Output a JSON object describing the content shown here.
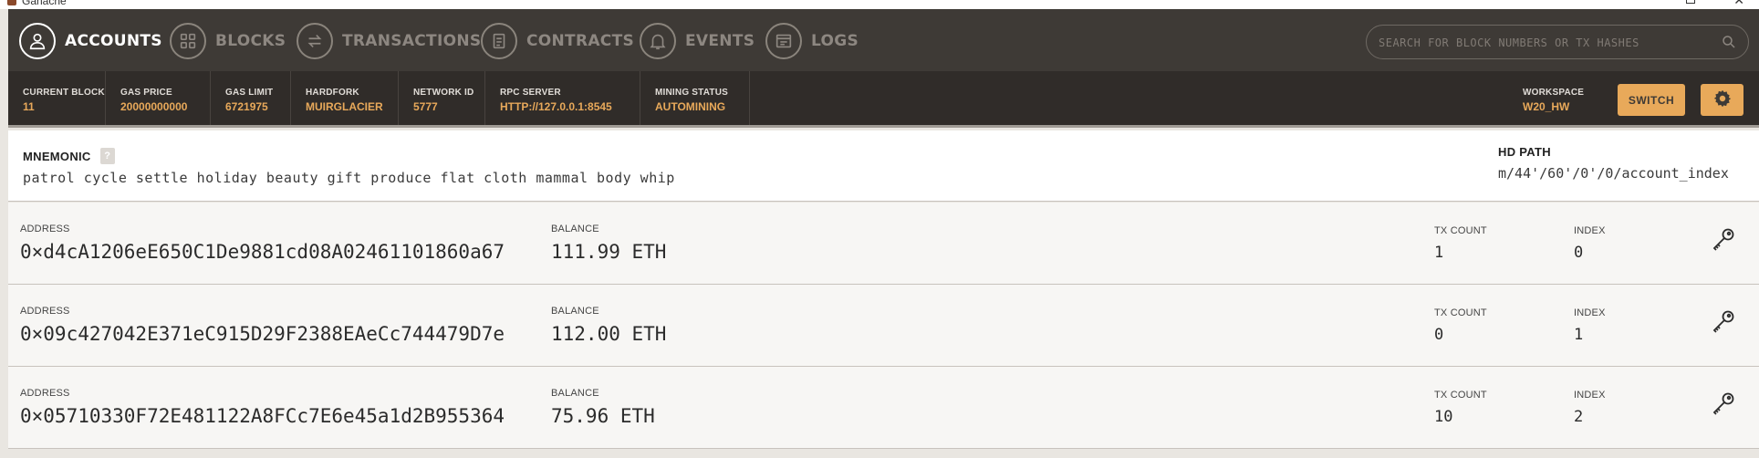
{
  "window": {
    "title": "Ganache"
  },
  "nav": {
    "items": [
      {
        "label": "ACCOUNTS",
        "icon": "user-icon",
        "active": true
      },
      {
        "label": "BLOCKS",
        "icon": "grid-icon",
        "active": false
      },
      {
        "label": "TRANSACTIONS",
        "icon": "transfer-arrows-icon",
        "active": false
      },
      {
        "label": "CONTRACTS",
        "icon": "document-icon",
        "active": false
      },
      {
        "label": "EVENTS",
        "icon": "bell-icon",
        "active": false
      },
      {
        "label": "LOGS",
        "icon": "terminal-icon",
        "active": false
      }
    ],
    "search_placeholder": "SEARCH FOR BLOCK NUMBERS OR TX HASHES"
  },
  "status": {
    "items": [
      {
        "label": "CURRENT BLOCK",
        "value": "11"
      },
      {
        "label": "GAS PRICE",
        "value": "20000000000"
      },
      {
        "label": "GAS LIMIT",
        "value": "6721975"
      },
      {
        "label": "HARDFORK",
        "value": "MUIRGLACIER"
      },
      {
        "label": "NETWORK ID",
        "value": "5777"
      },
      {
        "label": "RPC SERVER",
        "value": "HTTP://127.0.0.1:8545"
      },
      {
        "label": "MINING STATUS",
        "value": "AUTOMINING"
      }
    ],
    "workspace_label": "WORKSPACE",
    "workspace_value": "W20_HW",
    "switch_label": "SWITCH"
  },
  "mnemonic": {
    "title": "MNEMONIC",
    "help": "?",
    "phrase": "patrol cycle settle holiday beauty gift produce flat cloth mammal body whip",
    "hd_path_label": "HD PATH",
    "hd_path": "m/44'/60'/0'/0/account_index"
  },
  "accounts": [
    {
      "address_label": "ADDRESS",
      "address": "0×d4cA1206eE650C1De9881cd08A02461101860a67",
      "balance_label": "BALANCE",
      "balance": "111.99 ETH",
      "tx_count_label": "TX COUNT",
      "tx_count": "1",
      "index_label": "INDEX",
      "index": "0"
    },
    {
      "address_label": "ADDRESS",
      "address": "0×09c427042E371eC915D29F2388EAeCc744479D7e",
      "balance_label": "BALANCE",
      "balance": "112.00 ETH",
      "tx_count_label": "TX COUNT",
      "tx_count": "0",
      "index_label": "INDEX",
      "index": "1"
    },
    {
      "address_label": "ADDRESS",
      "address": "0×05710330F72E481122A8FCc7E6e45a1d2B955364",
      "balance_label": "BALANCE",
      "balance": "75.96 ETH",
      "tx_count_label": "TX COUNT",
      "tx_count": "10",
      "index_label": "INDEX",
      "index": "2"
    }
  ],
  "colors": {
    "accent": "#e8a95a",
    "nav_bg": "#3e3a36",
    "status_bg": "#302c29"
  }
}
